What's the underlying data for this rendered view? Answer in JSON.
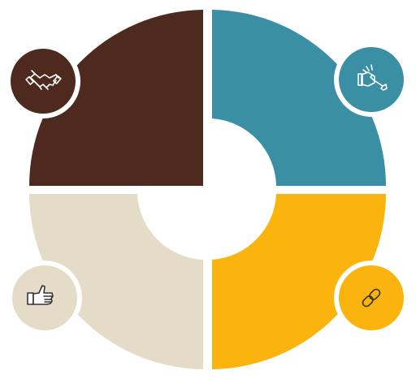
{
  "diagram": {
    "type": "four-quadrant-ring",
    "background": "#ffffff",
    "segments": [
      {
        "id": "top-left",
        "color": "#4e2a1e",
        "icon": "handshake-icon",
        "icon_color": "#ffffff"
      },
      {
        "id": "top-right",
        "color": "#3a8fa5",
        "icon": "hand-wrench-icon",
        "icon_color": "#ffffff"
      },
      {
        "id": "bottom-left",
        "color": "#e5dcc8",
        "icon": "thumbs-up-icon",
        "icon_color": "#333333"
      },
      {
        "id": "bottom-right",
        "color": "#fbb30d",
        "icon": "link-icon",
        "icon_color": "#333333"
      }
    ]
  }
}
